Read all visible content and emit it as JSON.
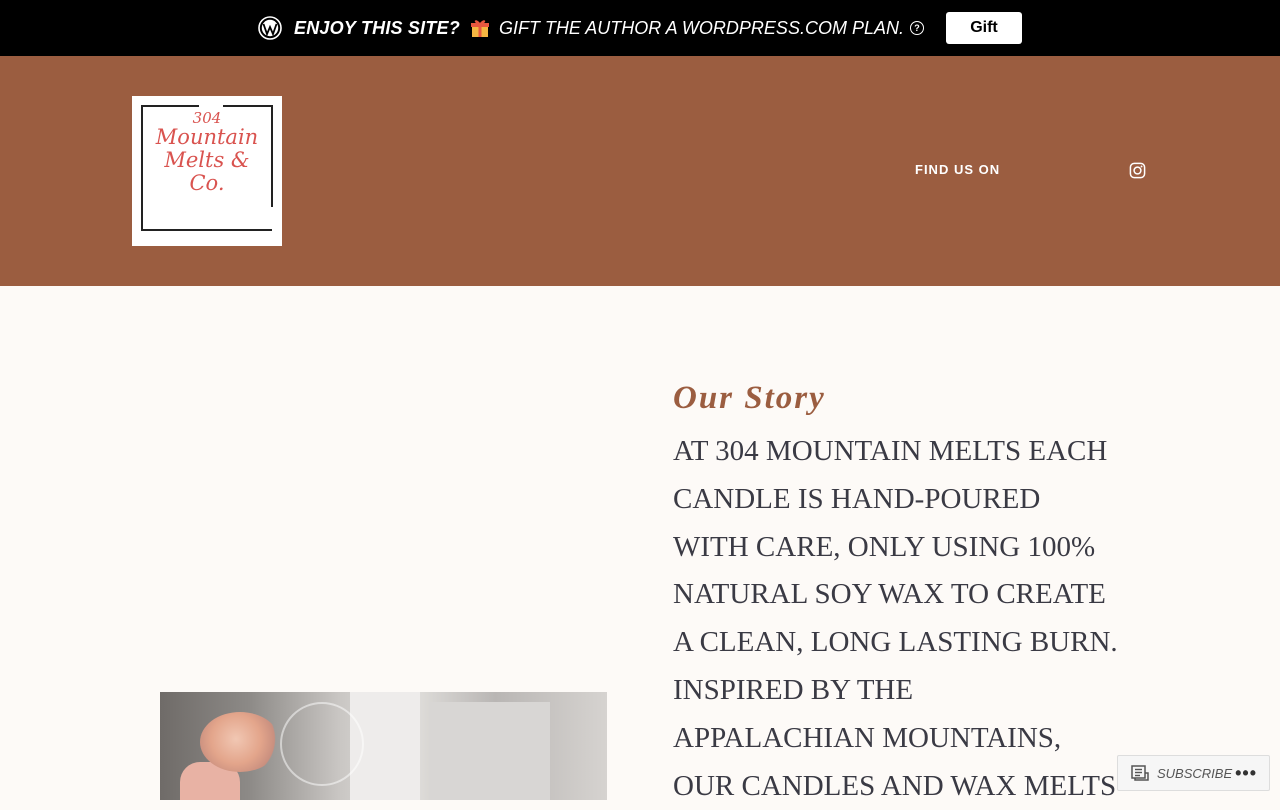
{
  "promo_bar": {
    "enjoy_text": "ENJOY THIS SITE?",
    "message": "GIFT THE AUTHOR A WORDPRESS.COM PLAN.",
    "help_symbol": "?",
    "gift_button": "Gift",
    "icons": [
      "wordpress-icon",
      "gift-icon",
      "help-icon"
    ]
  },
  "header": {
    "logo": {
      "line1": "304",
      "line2": "Mountain",
      "line3": "Melts &",
      "line4": "Co."
    },
    "find_us_label": "FIND US ON",
    "social_icon": "instagram-icon",
    "background_color": "#9b5d40"
  },
  "main": {
    "story_title": "Our Story",
    "story_lines": [
      "AT 304 MOUNTAIN MELTS EACH",
      "CANDLE IS HAND-POURED",
      "WITH CARE, ONLY USING 100%",
      "NATURAL SOY WAX TO CREATE",
      "A CLEAN, LONG LASTING BURN.",
      "INSPIRED BY THE",
      "APPALACHIAN MOUNTAINS,",
      "OUR CANDLES AND WAX MELTS"
    ]
  },
  "subscribe_bar": {
    "label": "SUBSCRIBE",
    "more": "•••",
    "icons": [
      "reader-icon",
      "more-icon"
    ]
  }
}
